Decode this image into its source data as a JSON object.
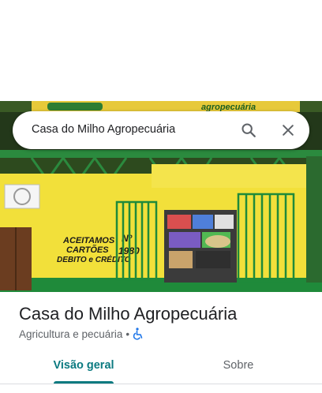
{
  "search": {
    "query": "Casa do Milho Agropecuária"
  },
  "icons": {
    "search": "search-icon",
    "close": "close-icon",
    "accessibility": "wheelchair-icon"
  },
  "colors": {
    "accent": "#0b7a80",
    "accessibility_icon": "#1a73e8",
    "storefront_wall": "#f2e03a",
    "storefront_trim": "#1f8a3a"
  },
  "place": {
    "name": "Casa do Milho Agropecuária",
    "category": "Agricultura e pecuária",
    "separator": "•"
  },
  "photo_signage": {
    "banner": "agropecuária",
    "wall_text_lines": [
      "ACEITAMOS",
      "CARTÕES",
      "DEBITO e CRÉDITO"
    ],
    "number_label": "Nº",
    "number": "1980"
  },
  "tabs": [
    {
      "label": "Visão geral",
      "selected": true
    },
    {
      "label": "Sobre",
      "selected": false
    }
  ]
}
